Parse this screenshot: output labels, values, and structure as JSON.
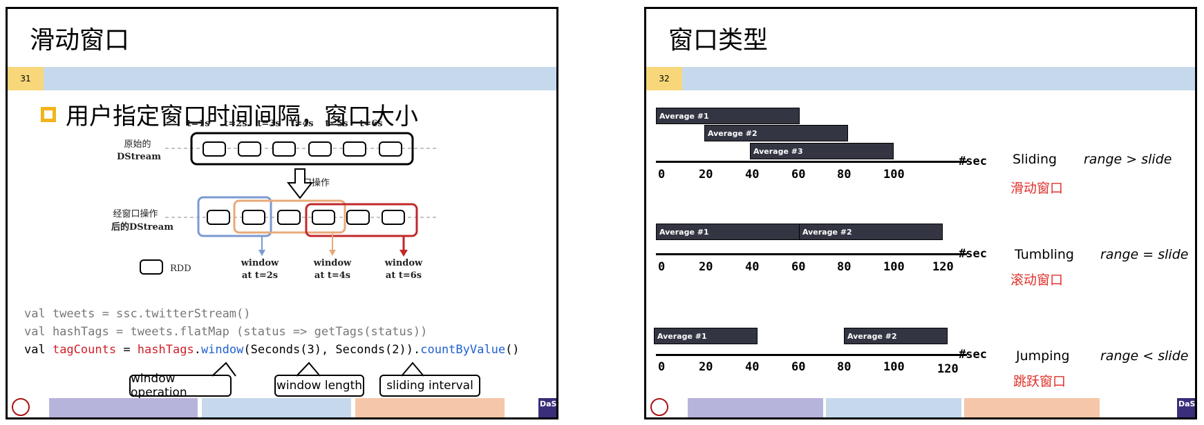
{
  "slide1": {
    "title": "滑动窗口",
    "number": "31",
    "bullet": "用户指定窗口时间间隔，窗口大小",
    "diagram": {
      "times": [
        "t=1s",
        "t=2s",
        "t=3s",
        "t=4s",
        "t=5s",
        "t=6s"
      ],
      "source_label_1": "原始的",
      "source_label_2": "DStream",
      "op_label": "窗口操作",
      "windowed_label_1": "经窗口操作",
      "windowed_label_2": "后的DStream",
      "rdd_label": "RDD",
      "windows": [
        {
          "l1": "window",
          "l2": "at t=2s"
        },
        {
          "l1": "window",
          "l2": "at t=4s"
        },
        {
          "l1": "window",
          "l2": "at t=6s"
        }
      ],
      "colors": {
        "blue": "#7a9ad1",
        "orange": "#e9a878",
        "red": "#c0282a"
      }
    },
    "code": {
      "line1": "val tweets = ssc.twitterStream()",
      "line2": "val hashTags = tweets.flatMap (status => getTags(status))",
      "l3_val": "val ",
      "l3_var": "tagCounts",
      "l3_eq": " = ",
      "l3_ht": "hashTags",
      "l3_dot": ".",
      "l3_window": "window",
      "l3_args": "(Seconds(3), Seconds(2)).",
      "l3_cbv": "countByValue",
      "l3_end": "()"
    },
    "callouts": [
      "window operation",
      "window length",
      "sliding interval"
    ],
    "logo": "DaSi"
  },
  "slide2": {
    "title": "窗口类型",
    "number": "32",
    "sec_label": "#sec",
    "rows": [
      {
        "name": "Sliding",
        "relation": "range > slide",
        "cn": "滑动窗口",
        "bars": [
          "Average #1",
          "Average #2",
          "Average #3"
        ],
        "ticks": [
          "0",
          "20",
          "40",
          "60",
          "80",
          "100"
        ]
      },
      {
        "name": "Tumbling",
        "relation": "range = slide",
        "cn": "滚动窗口",
        "bars": [
          "Average #1",
          "Average #2"
        ],
        "ticks": [
          "0",
          "20",
          "40",
          "60",
          "80",
          "100",
          "120"
        ]
      },
      {
        "name": "Jumping",
        "relation": "range < slide",
        "cn": "跳跃窗口",
        "bars": [
          "Average #1",
          "Average #2"
        ],
        "ticks": [
          "0",
          "20",
          "40",
          "60",
          "80",
          "100",
          "120"
        ]
      }
    ],
    "logo": "DaSi"
  },
  "footer_colors": [
    "#b7b4dc",
    "#c6d9ec",
    "#f5c7a8"
  ]
}
